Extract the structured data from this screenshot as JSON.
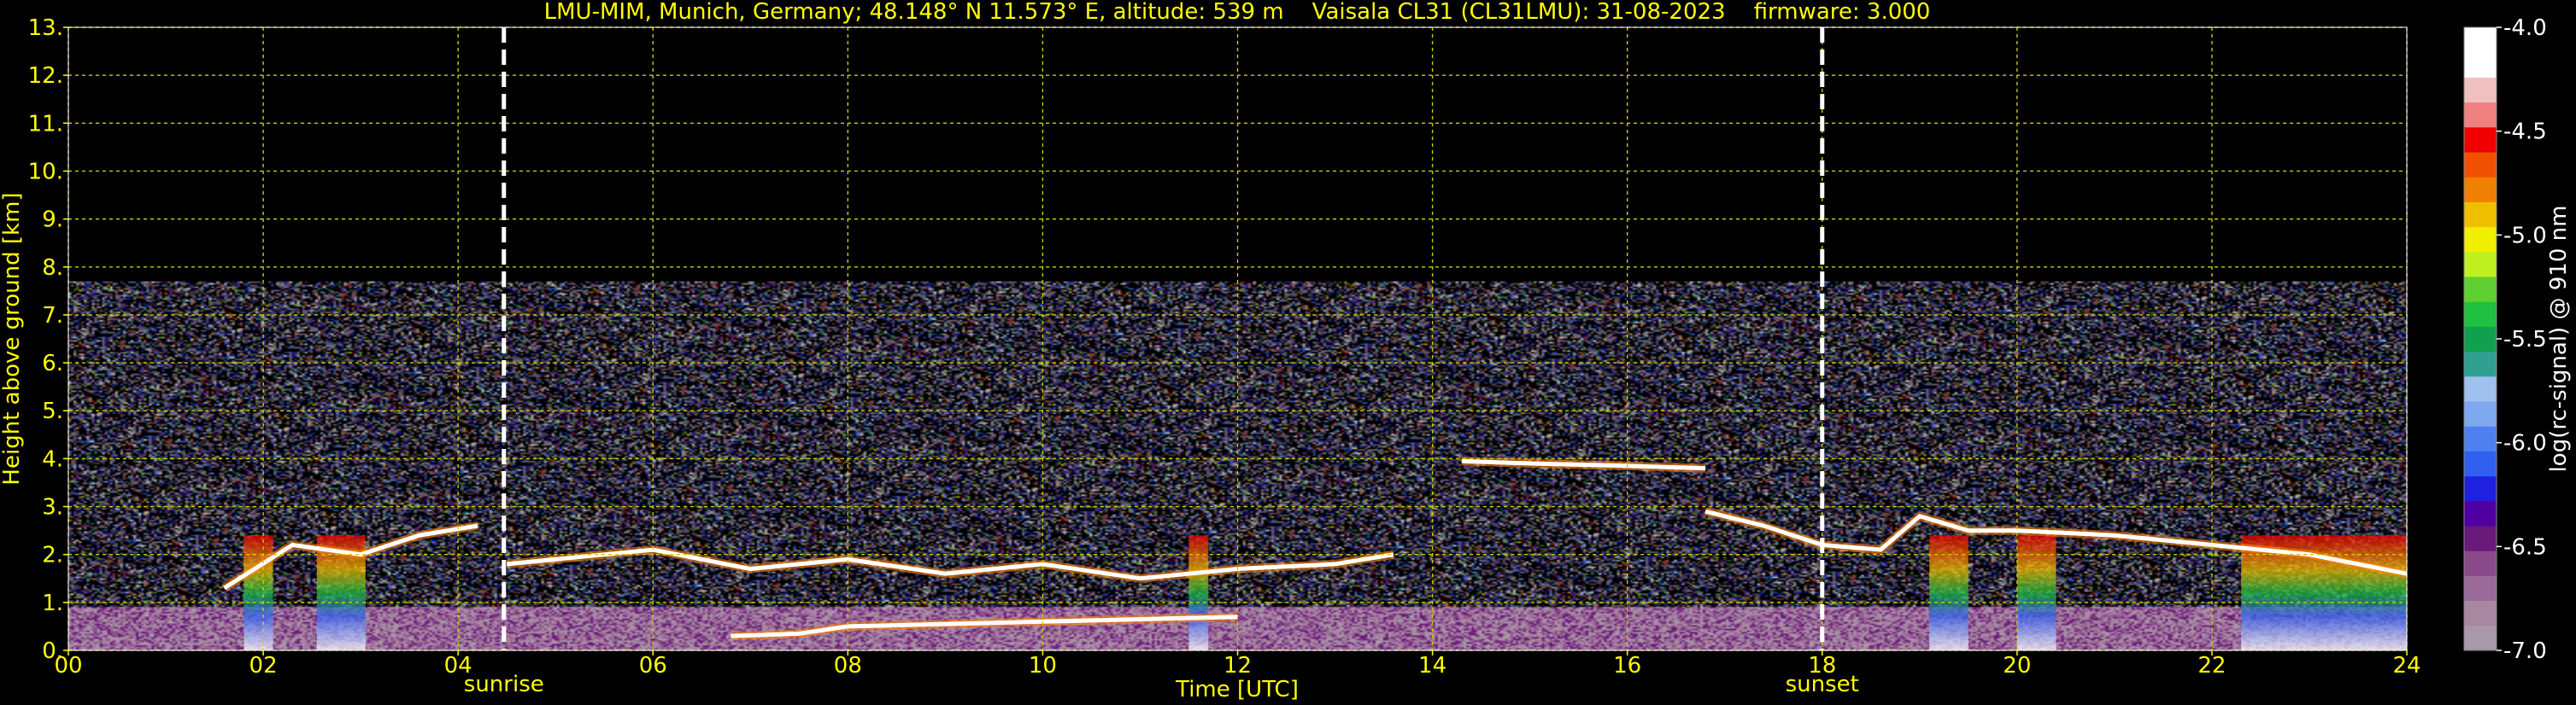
{
  "chart_data": {
    "type": "heatmap",
    "title": "LMU-MIM, Munich, Germany; 48.148° N 11.573° E, altitude: 539 m    Vaisala CL31 (CL31LMU): 31-08-2023    firmware: 3.000",
    "xlabel": "Time [UTC]",
    "ylabel": "Height above ground [km]",
    "x_ticks": [
      "00",
      "02",
      "04",
      "06",
      "08",
      "10",
      "12",
      "14",
      "16",
      "18",
      "20",
      "22",
      "24"
    ],
    "y_ticks": [
      "0.",
      "1.",
      "2.",
      "3.",
      "4.",
      "5.",
      "6.",
      "7.",
      "8.",
      "9.",
      "10.",
      "11.",
      "12.",
      "13."
    ],
    "xlim": [
      0,
      24
    ],
    "ylim": [
      0,
      13
    ],
    "grid": true,
    "colorbar": {
      "label": "log(rc-signal) @ 910 nm",
      "ticks": [
        "-4.0",
        "-4.5",
        "-5.0",
        "-5.5",
        "-6.0",
        "-6.5",
        "-7.0"
      ],
      "range": [
        -7.0,
        -4.0
      ],
      "colors": [
        "#a898a8",
        "#a888a0",
        "#9a6a98",
        "#8a4a8a",
        "#6a1a7a",
        "#5000a0",
        "#2020e0",
        "#3060f0",
        "#5080f0",
        "#80a8f0",
        "#a0c0f0",
        "#30a090",
        "#10a050",
        "#20c040",
        "#60d030",
        "#c0f020",
        "#f0f000",
        "#f0c000",
        "#f08000",
        "#f05000",
        "#f00000",
        "#f08080",
        "#f0c0c0",
        "#ffffff",
        "#ffffff"
      ]
    },
    "markers": [
      {
        "label": "sunrise",
        "time": 4.47
      },
      {
        "label": "sunset",
        "time": 18.0
      }
    ],
    "data_top_km": 7.7,
    "cloud_layers": [
      {
        "t": [
          1.6,
          2.3,
          3.0,
          3.6,
          4.2
        ],
        "h": [
          1.3,
          2.2,
          2.0,
          2.4,
          2.6
        ]
      },
      {
        "t": [
          4.5,
          5.0,
          6.0,
          7.0,
          8.0,
          9.0,
          10.0,
          11.0,
          12.0,
          13.0,
          13.6
        ],
        "h": [
          1.8,
          1.9,
          2.1,
          1.7,
          1.9,
          1.6,
          1.8,
          1.5,
          1.7,
          1.8,
          2.0
        ]
      },
      {
        "t": [
          14.3,
          15.0,
          16.0,
          16.8
        ],
        "h": [
          3.95,
          3.9,
          3.85,
          3.8
        ]
      },
      {
        "t": [
          16.8,
          17.4,
          18.0,
          18.6,
          19.0,
          19.5,
          20.0,
          21.0,
          22.0,
          23.0,
          24.0
        ],
        "h": [
          2.9,
          2.6,
          2.2,
          2.1,
          2.8,
          2.5,
          2.5,
          2.4,
          2.2,
          2.0,
          1.6
        ]
      },
      {
        "t": [
          6.8,
          7.5,
          8.0,
          9.0,
          10.0,
          11.0,
          12.0
        ],
        "h": [
          0.3,
          0.35,
          0.5,
          0.55,
          0.6,
          0.65,
          0.7
        ]
      }
    ],
    "precip_columns": [
      {
        "t0": 1.8,
        "t1": 2.1
      },
      {
        "t0": 2.55,
        "t1": 3.05
      },
      {
        "t0": 11.5,
        "t1": 11.7
      },
      {
        "t0": 19.1,
        "t1": 19.5
      },
      {
        "t0": 20.0,
        "t1": 20.4
      },
      {
        "t0": 22.3,
        "t1": 24.0
      }
    ]
  }
}
